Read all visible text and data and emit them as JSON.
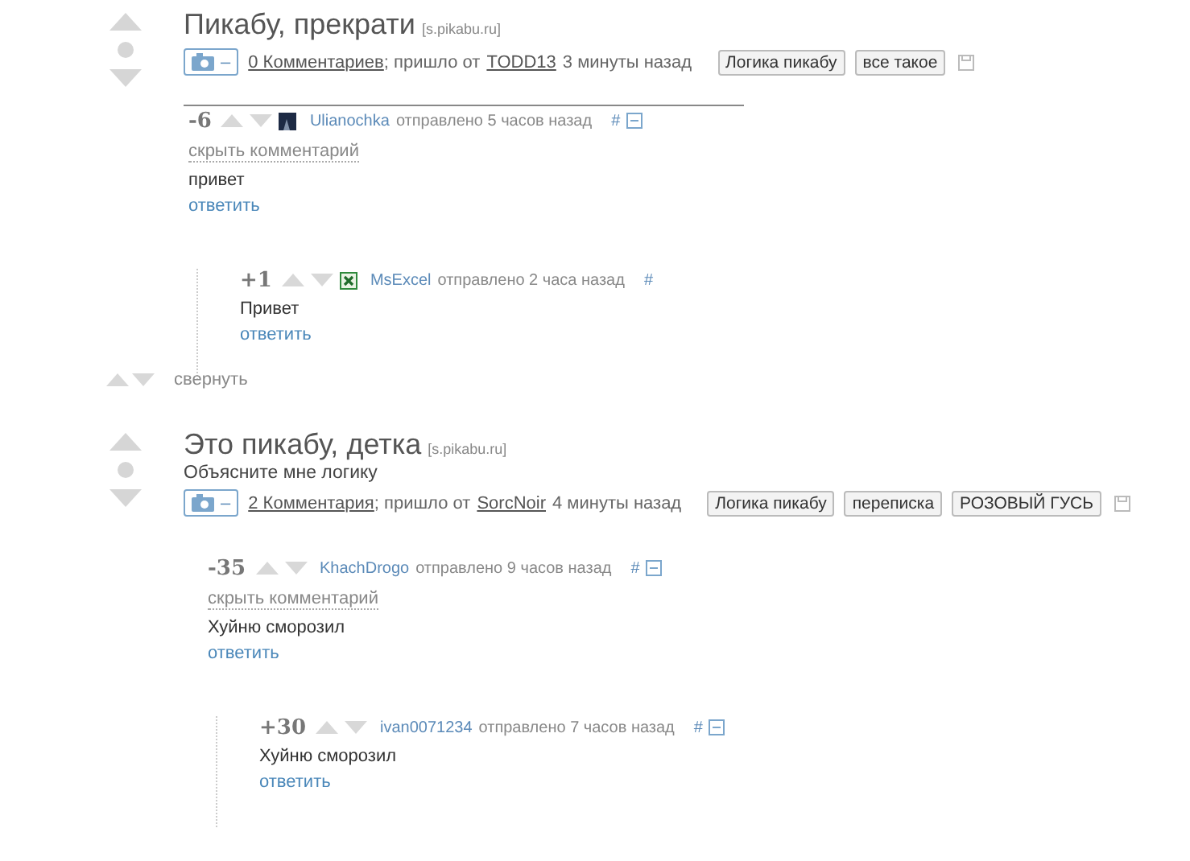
{
  "posts": [
    {
      "title": "Пикабу, прекрати",
      "source": "[s.pikabu.ru]",
      "picture_count": "–",
      "comments_link": "0 Комментариев",
      "from_label": "; пришло от",
      "author": "TODD13",
      "time": "3 минуты назад",
      "tags": [
        "Логика пикабу",
        "все такое"
      ],
      "separator": true,
      "collapse_label": "свернуть",
      "comments": [
        {
          "score": "-6",
          "author": "Ulianochka",
          "kind": "photo-avatar",
          "sent": "отправлено 5 часов назад",
          "hash": "#",
          "collapse_box": true,
          "hide_link": "скрыть комментарий",
          "text": "привет",
          "reply": "ответить",
          "children": [
            {
              "score": "+1",
              "author": "MsExcel",
              "kind": "sheet-avatar",
              "sent": "отправлено 2 часа назад",
              "hash": "#",
              "collapse_box": false,
              "text": "Привет",
              "reply": "ответить"
            }
          ]
        }
      ]
    },
    {
      "title": "Это пикабу, детка",
      "source": "[s.pikabu.ru]",
      "subtitle": "Объясните мне логику",
      "picture_count": "–",
      "comments_link": "2 Комментария",
      "from_label": "; пришло от",
      "author": "SorcNoir",
      "time": "4 минуты назад",
      "tags": [
        "Логика пикабу",
        "переписка",
        "РОЗОВЫЙ ГУСЬ"
      ],
      "separator": false,
      "comments": [
        {
          "score": "-35",
          "author": "KhachDrogo",
          "sent": "отправлено 9 часов назад",
          "hash": "#",
          "collapse_box": true,
          "hide_link": "скрыть комментарий",
          "text": "Хуйню сморозил",
          "reply": "ответить",
          "children": [
            {
              "score": "+30",
              "author": "ivan0071234",
              "sent": "отправлено 7 часов назад",
              "hash": "#",
              "collapse_box": true,
              "text": "Хуйню сморозил",
              "reply": "ответить"
            }
          ]
        }
      ]
    }
  ]
}
